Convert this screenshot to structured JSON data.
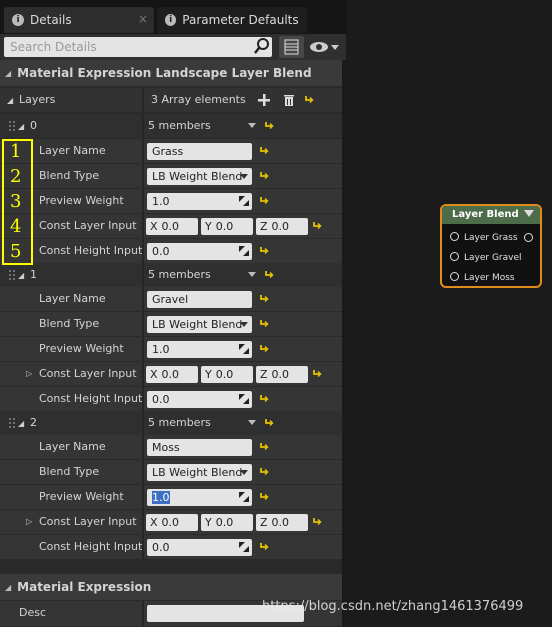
{
  "tabs": [
    {
      "label": "Details",
      "icon": "info-icon"
    },
    {
      "label": "Parameter Defaults",
      "icon": "info-icon"
    }
  ],
  "search": {
    "placeholder": "Search Details"
  },
  "section_title": "Material Expression Landscape Layer Blend",
  "layers": {
    "label": "Layers",
    "count_text": "3 Array elements"
  },
  "labels": {
    "layer_name": "Layer Name",
    "blend_type": "Blend Type",
    "preview_weight": "Preview Weight",
    "const_layer_input": "Const Layer Input",
    "const_height_input": "Const Height Input"
  },
  "elements": [
    {
      "index": "0",
      "members": "5 members",
      "layer_name": "Grass",
      "blend_type": "LB Weight Blend",
      "preview_weight": "1.0",
      "x": "0.0",
      "y": "0.0",
      "z": "0.0",
      "height": "0.0"
    },
    {
      "index": "1",
      "members": "5 members",
      "layer_name": "Gravel",
      "blend_type": "LB Weight Blend",
      "preview_weight": "1.0",
      "x": "0.0",
      "y": "0.0",
      "z": "0.0",
      "height": "0.0"
    },
    {
      "index": "2",
      "members": "5 members",
      "layer_name": "Moss",
      "blend_type": "LB Weight Blend",
      "preview_weight": "1.0",
      "x": "0.0",
      "y": "0.0",
      "z": "0.0",
      "height": "0.0"
    }
  ],
  "axis": {
    "x": "X",
    "y": "Y",
    "z": "Z"
  },
  "annotations": [
    "1",
    "2",
    "3",
    "4",
    "5"
  ],
  "section2_title": "Material Expression",
  "desc_label": "Desc",
  "node": {
    "title": "Layer Blend",
    "pins": [
      "Layer Grass",
      "Layer Gravel",
      "Layer Moss"
    ]
  },
  "watermark": "https://blog.csdn.net/zhang1461376499",
  "colors": {
    "accent": "#e08b1a",
    "annotation": "#ffff00",
    "node_header": "#4d6d4a",
    "reset_arrow": "#e6c300"
  }
}
